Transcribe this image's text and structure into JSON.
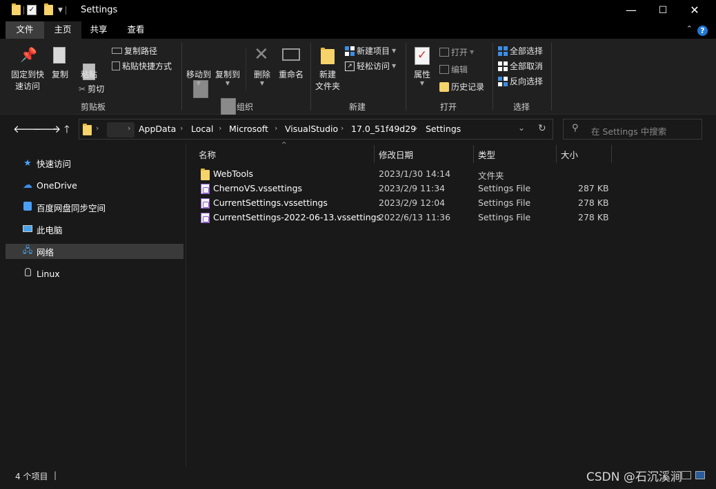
{
  "window": {
    "title": "Settings",
    "minimize": "—",
    "maximize": "☐",
    "close": "✕"
  },
  "ribbon_tabs": [
    "文件",
    "主页",
    "共享",
    "查看"
  ],
  "ribbon": {
    "clipboard": {
      "pin": "固定到快速访问",
      "pin_l1": "固定到快",
      "pin_l2": "速访问",
      "copy": "复制",
      "paste": "粘贴",
      "copy_path": "复制路径",
      "paste_shortcut": "粘贴快捷方式",
      "cut": "剪切",
      "label": "剪贴板"
    },
    "organize": {
      "move_to": "移动到",
      "copy_to": "复制到",
      "delete": "删除",
      "rename": "重命名",
      "label": "组织"
    },
    "new": {
      "new_folder_l1": "新建",
      "new_folder_l2": "文件夹",
      "new_item": "新建项目",
      "easy_access": "轻松访问",
      "label": "新建"
    },
    "open": {
      "properties": "属性",
      "open": "打开",
      "edit": "编辑",
      "history": "历史记录",
      "label": "打开"
    },
    "select": {
      "select_all": "全部选择",
      "select_none": "全部取消",
      "invert": "反向选择",
      "label": "选择"
    }
  },
  "address": {
    "crumbs": [
      "AppData",
      "Local",
      "Microsoft",
      "VisualStudio",
      "17.0_51f49d29",
      "Settings"
    ],
    "search_placeholder": "在 Settings 中搜索"
  },
  "sidebar": {
    "items": [
      {
        "label": "快速访问",
        "icon": "star-icon"
      },
      {
        "label": "OneDrive",
        "icon": "cloud-icon"
      },
      {
        "label": "百度网盘同步空间",
        "icon": "baidu-sync-icon"
      },
      {
        "label": "此电脑",
        "icon": "computer-icon"
      },
      {
        "label": "网络",
        "icon": "network-icon",
        "selected": true
      },
      {
        "label": "Linux",
        "icon": "linux-penguin-icon"
      }
    ]
  },
  "columns": {
    "name": "名称",
    "date": "修改日期",
    "type": "类型",
    "size": "大小"
  },
  "files": [
    {
      "name": "WebTools",
      "date": "2023/1/30 14:14",
      "type": "文件夹",
      "size": "",
      "icon": "folder-icon"
    },
    {
      "name": "ChernoVS.vssettings",
      "date": "2023/2/9 11:34",
      "type": "Settings File",
      "size": "287 KB",
      "icon": "vssettings-icon"
    },
    {
      "name": "CurrentSettings.vssettings",
      "date": "2023/2/9 12:04",
      "type": "Settings File",
      "size": "278 KB",
      "icon": "vssettings-icon"
    },
    {
      "name": "CurrentSettings-2022-06-13.vssettings",
      "date": "2022/6/13 11:36",
      "type": "Settings File",
      "size": "278 KB",
      "icon": "vssettings-icon"
    }
  ],
  "status": {
    "count": "4 个项目",
    "watermark": "CSDN @石沉溪涧"
  },
  "colors": {
    "background": "#191919",
    "accent": "#1e78d6",
    "folder": "#f6d36b"
  }
}
